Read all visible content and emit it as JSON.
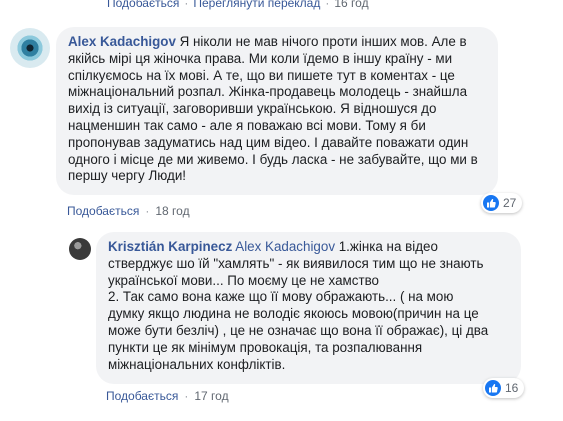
{
  "top_actions": {
    "like_label": "Подобається",
    "translate_label": "Переглянути переклад",
    "time": "16 год"
  },
  "comments": [
    {
      "author": "Alex Kadachigov",
      "text": "Я ніколи не мав нічого проти інших мов. Але в\nякійсь мірі ця жіночка права. Ми коли їдемо в іншу країну - ми\nспілкуємось на їх мові. А те, що ви пишете тут в коментах - це\nміжнаціональний розпал. Жінка-продавець молодець - знайшла\nвихід із ситуації, заговоривши українською. Я відношуся до\nнацменшин так само - але я поважаю всі мови. Тому я би\nпропонував задуматись над цим відео. І давайте поважати один\nодного і місце де ми живемо. І будь ласка - не забувайте, що ми в\nпершу чергу Люди!",
      "reaction_count": "27",
      "like_label": "Подобається",
      "time": "18 год"
    },
    {
      "author": "Krisztián Karpinecz",
      "mention": "Alex Kadachigov",
      "text": " 1.жінка на відео\nстверджує шо їй \"хамлять\" - як виявилося тим що не знають\nукраїнської мови... По моєму це не хамство\n2. Так само вона каже що її мову ображають... ( на мою\nдумку якщо людина не володіє якоюсь мовою(причин на це\nможе бути безліч) , це не означає що вона її ображає), ці два\nпункти це як мінімум провокація, та розпалювання\nміжнаціональних конфліктів.",
      "reaction_count": "16",
      "like_label": "Подобається",
      "time": "17 год"
    }
  ],
  "colors": {
    "link": "#385898",
    "bubble": "#f2f3f5",
    "meta": "#606770",
    "like": "#1877f2"
  }
}
